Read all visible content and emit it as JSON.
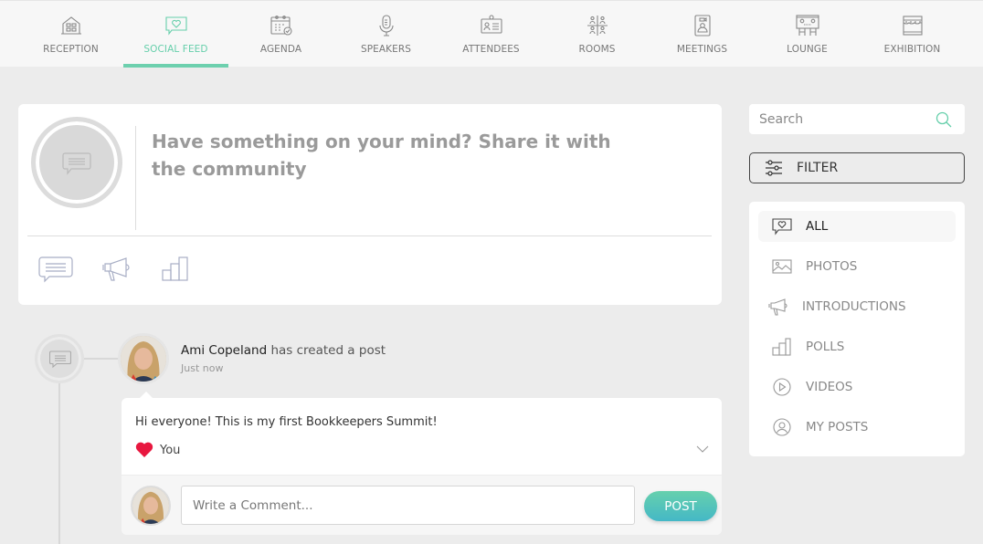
{
  "nav": {
    "items": [
      {
        "label": "RECEPTION",
        "icon": "building-icon"
      },
      {
        "label": "SOCIAL FEED",
        "icon": "chat-heart-icon",
        "active": true
      },
      {
        "label": "AGENDA",
        "icon": "calendar-check-icon"
      },
      {
        "label": "SPEAKERS",
        "icon": "microphone-icon"
      },
      {
        "label": "ATTENDEES",
        "icon": "id-card-icon"
      },
      {
        "label": "ROOMS",
        "icon": "rooms-icon"
      },
      {
        "label": "MEETINGS",
        "icon": "video-badge-icon"
      },
      {
        "label": "LOUNGE",
        "icon": "lounge-icon"
      },
      {
        "label": "EXHIBITION",
        "icon": "booth-icon"
      }
    ],
    "accent_color": "#6dd0ae"
  },
  "composer": {
    "prompt": "Have something on your mind? Share it with the community",
    "tools": [
      "message-icon",
      "megaphone-icon",
      "poll-icon"
    ]
  },
  "post": {
    "author": "Ami Copeland",
    "action": "has created a post",
    "time": "Just now",
    "text": "Hi everyone! This is my first Bookkeepers Summit!",
    "reaction_label": "You",
    "reaction_color": "#e8173f",
    "comment_placeholder": "Write a Comment...",
    "post_button": "POST"
  },
  "sidebar": {
    "search_placeholder": "Search",
    "filter_label": "FILTER",
    "filters": [
      {
        "label": "ALL",
        "icon": "chat-heart-icon",
        "active": true
      },
      {
        "label": "PHOTOS",
        "icon": "image-icon"
      },
      {
        "label": "INTRODUCTIONS",
        "icon": "megaphone-icon"
      },
      {
        "label": "POLLS",
        "icon": "poll-icon"
      },
      {
        "label": "VIDEOS",
        "icon": "play-circle-icon"
      },
      {
        "label": "MY POSTS",
        "icon": "user-circle-icon"
      }
    ]
  }
}
